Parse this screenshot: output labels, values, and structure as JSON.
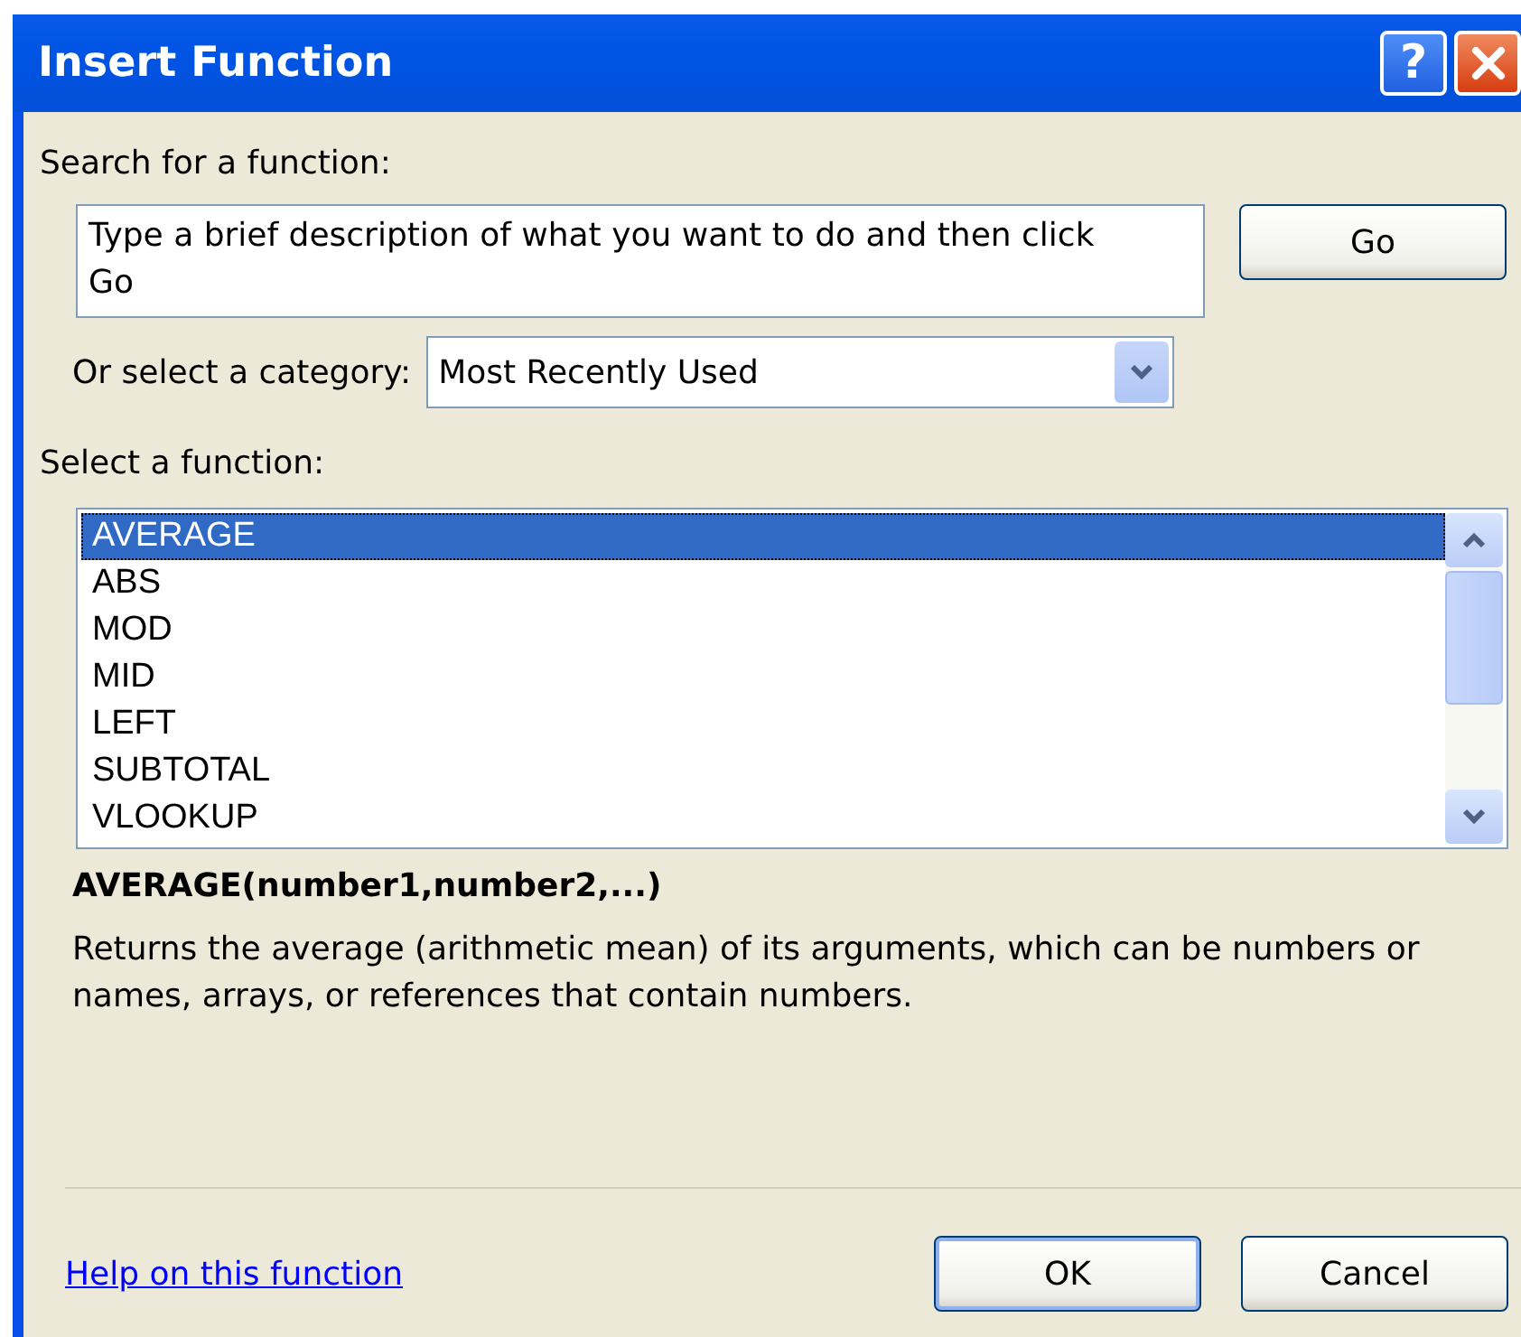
{
  "window": {
    "title": "Insert Function",
    "help_button": "?"
  },
  "search": {
    "label": "Search for a function:",
    "value": "Type a brief description of what you want to do and then click Go",
    "go_button": "Go"
  },
  "category": {
    "label": "Or select a category:",
    "value": "Most Recently Used"
  },
  "functions": {
    "label": "Select a function:",
    "items": [
      {
        "name": "AVERAGE",
        "selected": true
      },
      {
        "name": "ABS",
        "selected": false
      },
      {
        "name": "MOD",
        "selected": false
      },
      {
        "name": "MID",
        "selected": false
      },
      {
        "name": "LEFT",
        "selected": false
      },
      {
        "name": "SUBTOTAL",
        "selected": false
      },
      {
        "name": "VLOOKUP",
        "selected": false
      }
    ]
  },
  "signature": "AVERAGE(number1,number2,...)",
  "description": "Returns the average (arithmetic mean) of its arguments, which can be numbers or names, arrays, or references that contain numbers.",
  "help_link": "Help on this function",
  "buttons": [
    {
      "label": "OK",
      "kind": "default"
    },
    {
      "label": "Cancel",
      "kind": "normal"
    }
  ]
}
